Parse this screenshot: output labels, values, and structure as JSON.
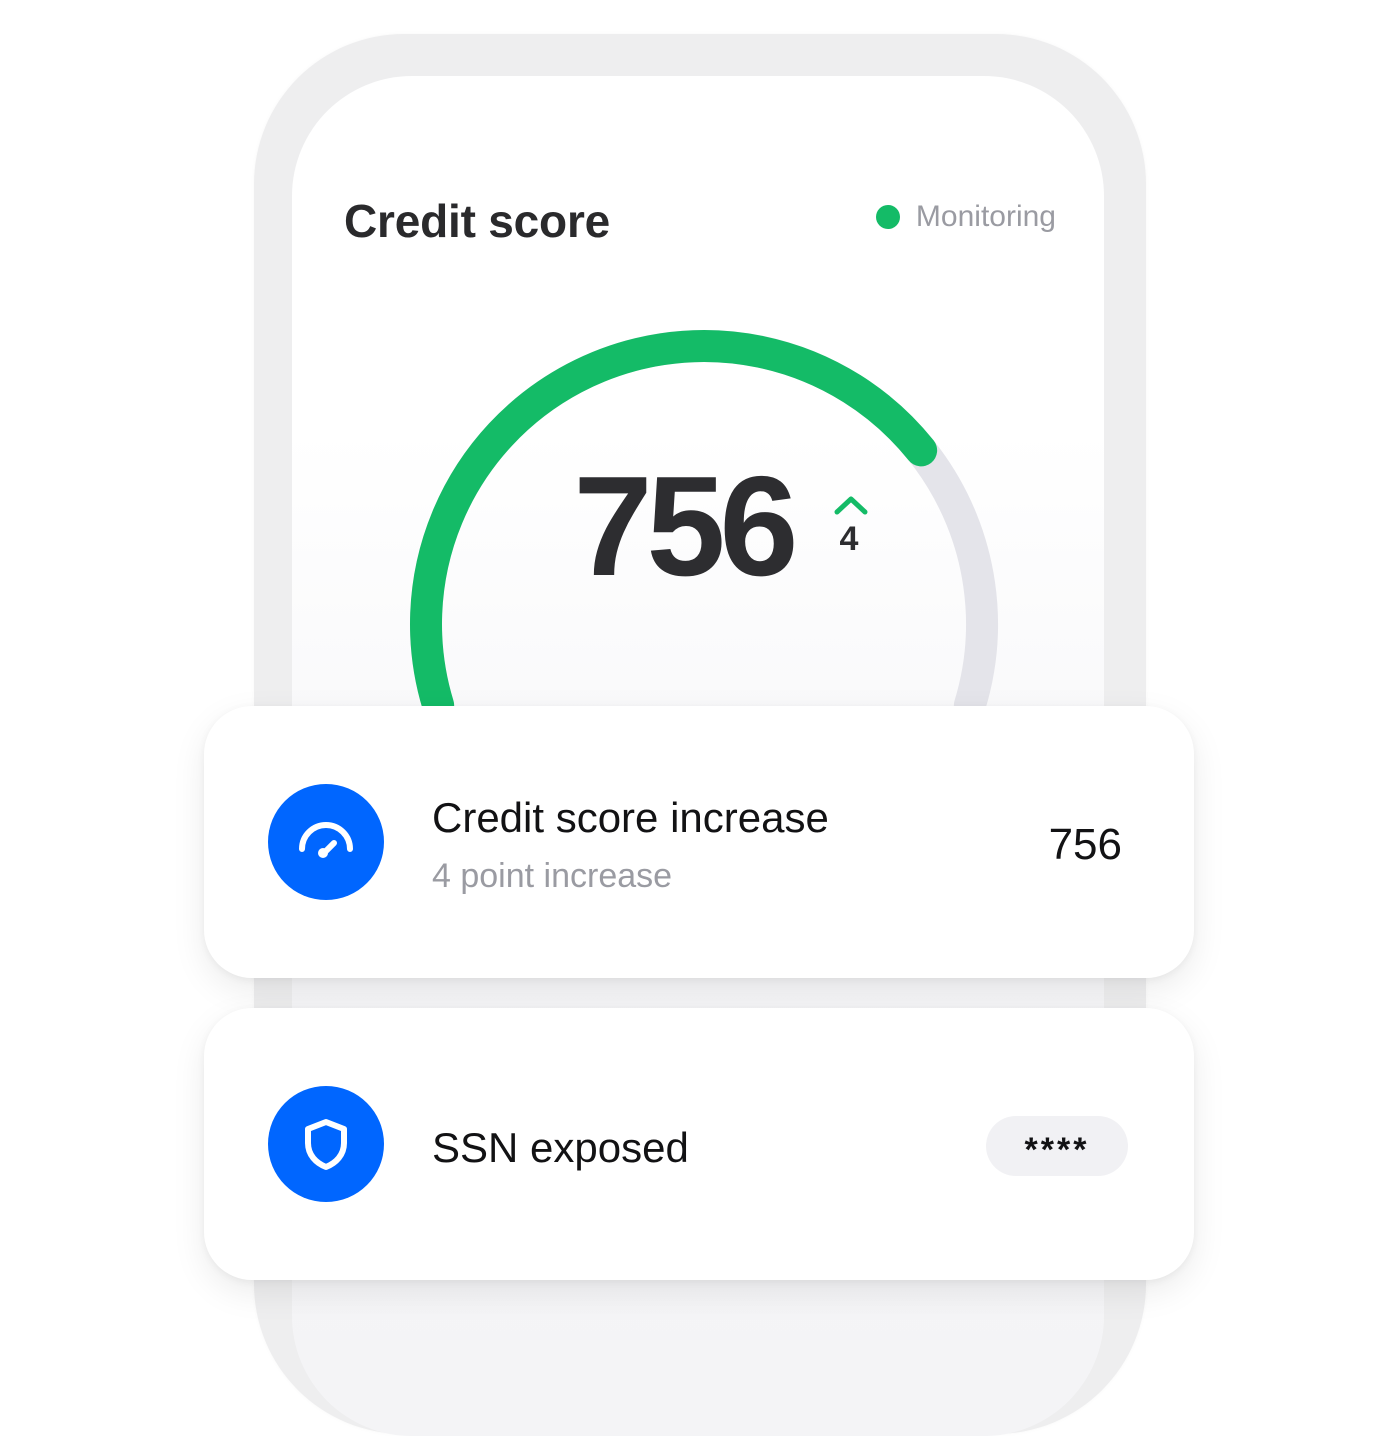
{
  "credit_score": {
    "title": "Credit score",
    "status_label": "Monitoring",
    "status_color": "#14bb67",
    "score_display": "756",
    "score_value": 756,
    "change": "4",
    "change_direction": "up",
    "gauge_filled_fraction": 0.74,
    "gauge_fill_color": "#14bb67",
    "gauge_track_color": "#e4e4ea"
  },
  "cards": [
    {
      "icon": "speedometer-icon",
      "title": "Credit score increase",
      "subtitle": "4 point increase",
      "value": "756"
    },
    {
      "icon": "shield-icon",
      "title": "SSN exposed",
      "masked_value": "****"
    }
  ],
  "colors": {
    "accent_blue": "#0066ff",
    "success_green": "#14bb67",
    "muted_text": "#9a9ba2",
    "primary_text": "#2d2d30"
  }
}
